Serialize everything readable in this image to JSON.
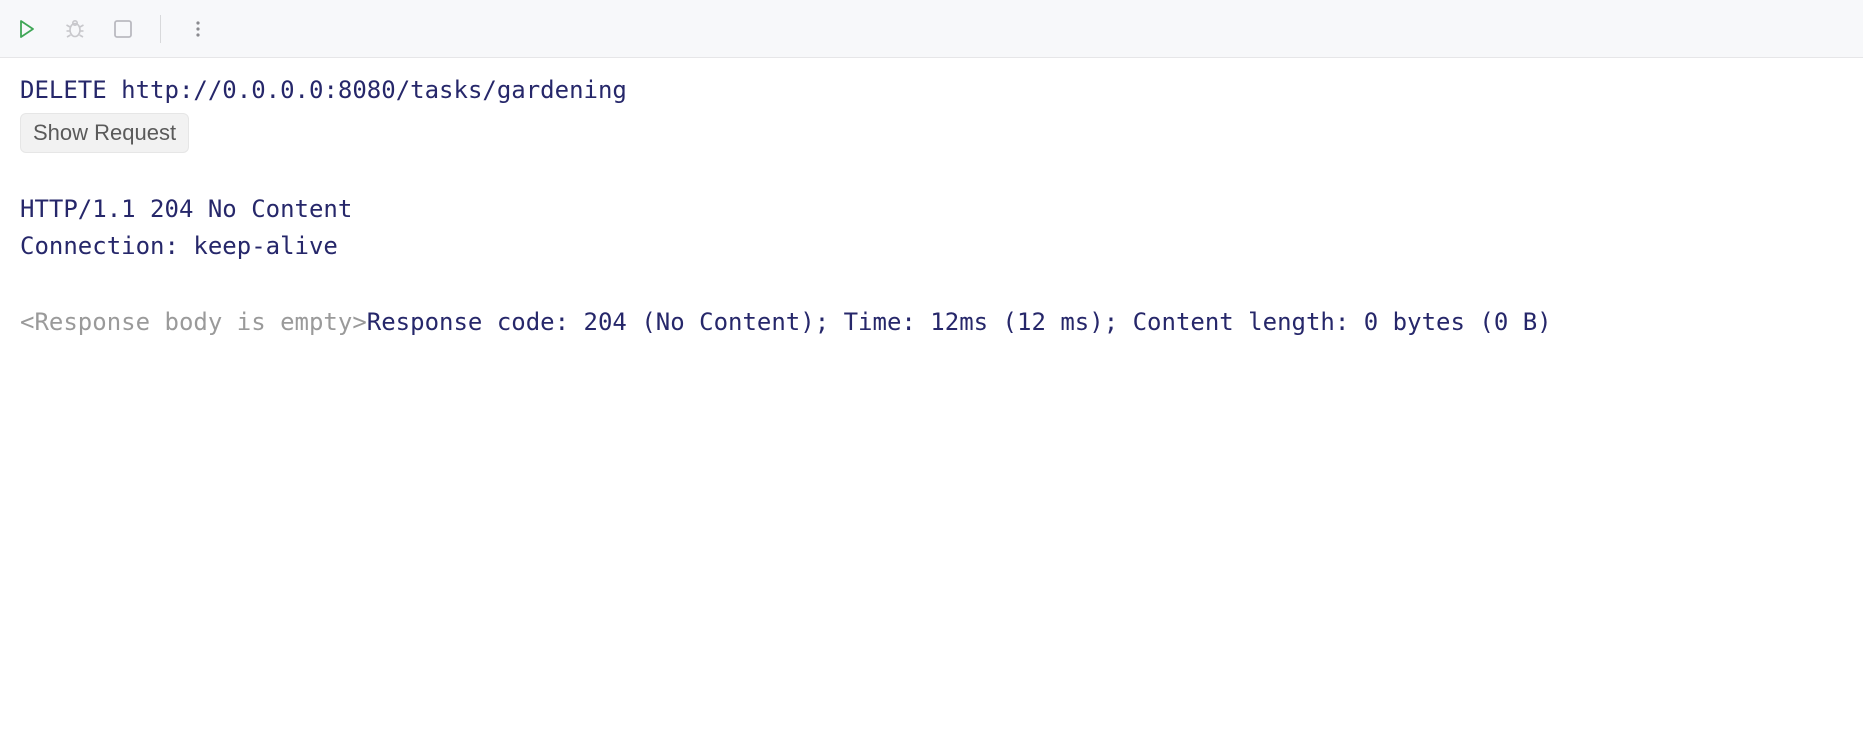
{
  "request": {
    "method": "DELETE",
    "url": "http://0.0.0.0:8080/tasks/gardening",
    "show_request_label": "Show Request"
  },
  "response": {
    "status_line": "HTTP/1.1 204 No Content",
    "headers": [
      "Connection: keep-alive"
    ],
    "body_empty_text": "<Response body is empty>",
    "summary": "Response code: 204 (No Content); Time: 12ms (12 ms); Content length: 0 bytes (0 B)"
  }
}
